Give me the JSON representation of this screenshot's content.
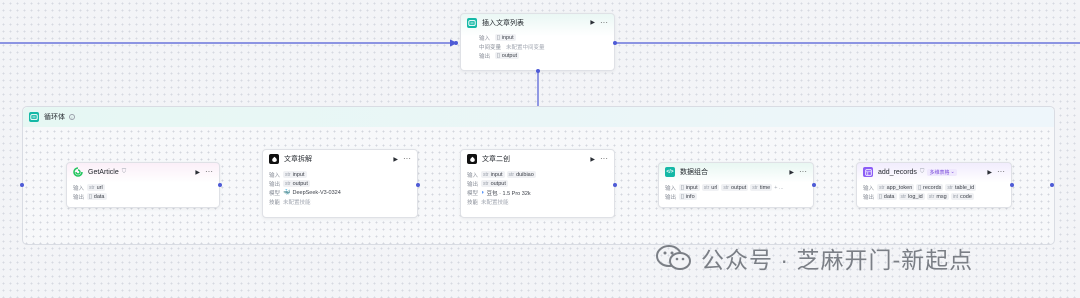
{
  "nodes": {
    "insert": {
      "title": "插入文章列表",
      "rows": [
        {
          "label": "输入",
          "type": "[]",
          "value": "input"
        },
        {
          "label": "中间变量",
          "plain": "未配置中间变量"
        },
        {
          "label": "输出",
          "type": "[]",
          "value": "output"
        }
      ]
    },
    "loop": {
      "title": "循环体"
    },
    "get_article": {
      "title": "GetArticle",
      "rows": [
        {
          "label": "输入",
          "type": "str",
          "value": "url"
        },
        {
          "label": "输出",
          "type": "[]",
          "value": "data"
        }
      ]
    },
    "split": {
      "title": "文章拆解",
      "rows": [
        {
          "label": "输入",
          "type": "str",
          "value": "input"
        },
        {
          "label": "输出",
          "type": "str",
          "value": "output"
        },
        {
          "label": "模型",
          "plain": "DeepSeek-V3-0324"
        },
        {
          "label": "技能",
          "muted": "未配置技能"
        }
      ]
    },
    "rewrite": {
      "title": "文章二创",
      "rows": [
        {
          "label": "输入",
          "tags": [
            {
              "type": "str",
              "value": "input"
            },
            {
              "type": "str",
              "value": "duibiao"
            }
          ]
        },
        {
          "label": "输出",
          "type": "str",
          "value": "output"
        },
        {
          "label": "模型",
          "plain": "豆包 · 1.5 Pro 32k"
        },
        {
          "label": "技能",
          "muted": "未配置技能"
        }
      ]
    },
    "combine": {
      "title": "数据组合",
      "rows": [
        {
          "label": "输入",
          "tags": [
            {
              "type": "[]",
              "value": "input"
            },
            {
              "type": "str",
              "value": "url"
            },
            {
              "type": "str",
              "value": "output"
            },
            {
              "type": "str",
              "value": "time"
            }
          ],
          "extra": "+ ..."
        },
        {
          "label": "输出",
          "type": "[]",
          "value": "info"
        }
      ]
    },
    "add_records": {
      "title": "add_records",
      "badge": "多维表格",
      "rows": [
        {
          "label": "输入",
          "tags": [
            {
              "type": "str",
              "value": "app_token"
            },
            {
              "type": "[]",
              "value": "records"
            },
            {
              "type": "str",
              "value": "table_id"
            }
          ]
        },
        {
          "label": "输出",
          "tags": [
            {
              "type": "[]",
              "value": "data"
            },
            {
              "type": "str",
              "value": "log_id"
            },
            {
              "type": "str",
              "value": "msg"
            },
            {
              "type": "int",
              "value": "code"
            }
          ]
        }
      ]
    }
  },
  "watermark": {
    "text": "公众号 · 芝麻开门-新起点"
  },
  "colors": {
    "edge": "#4e5bd6",
    "teal": "#14b8a6",
    "purple": "#8b5cf6",
    "green": "#22c55e",
    "dark": "#111111"
  }
}
